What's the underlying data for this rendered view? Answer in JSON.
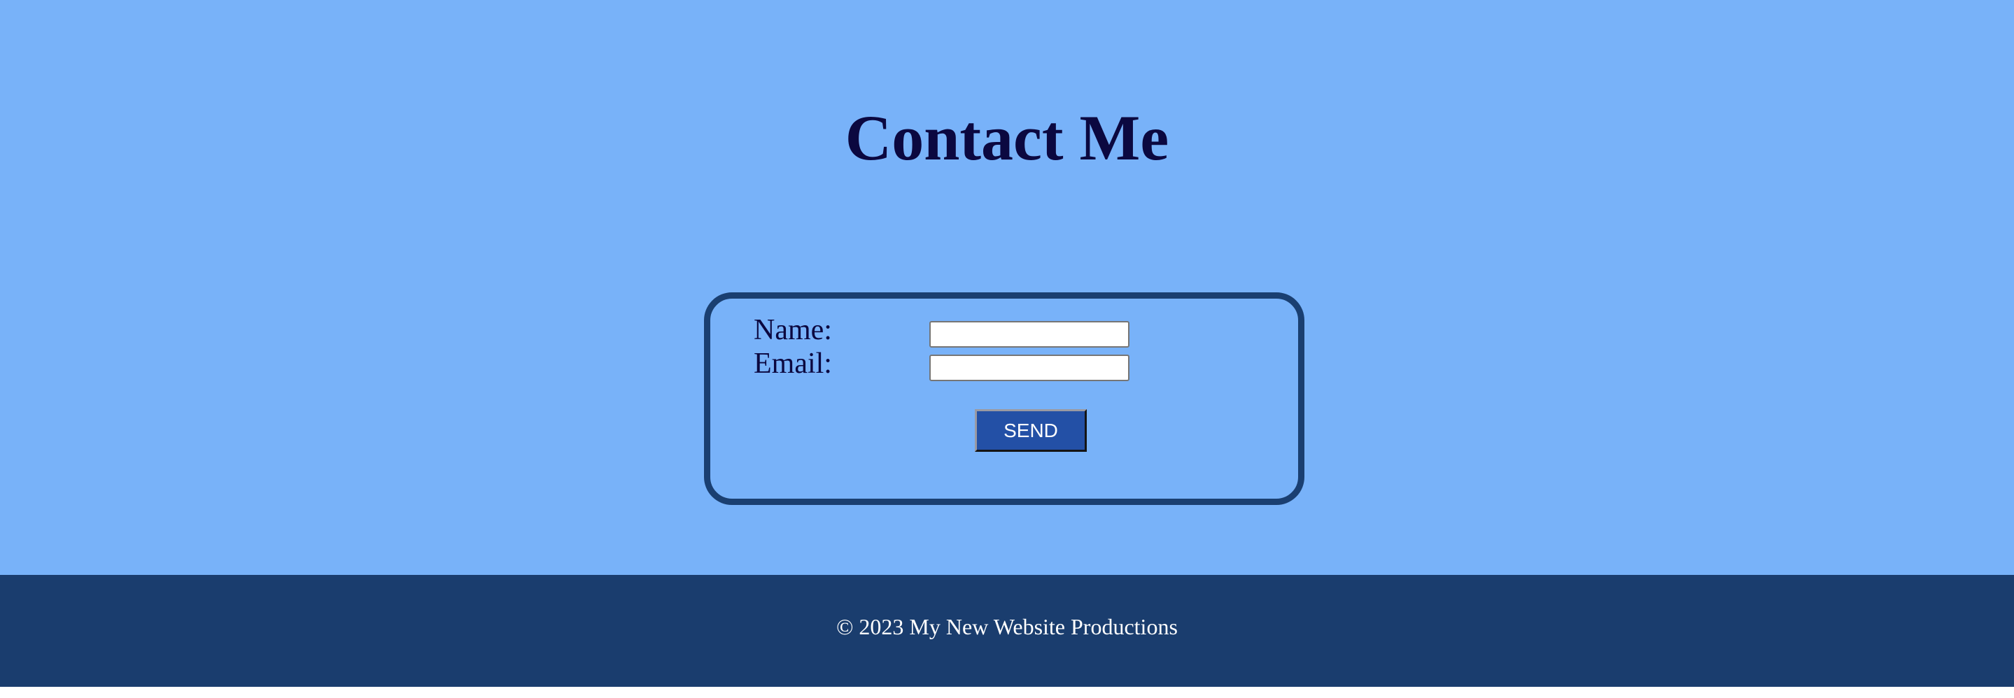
{
  "header": {
    "title": "Contact Me"
  },
  "form": {
    "name_label": "Name:",
    "name_value": "",
    "email_label": "Email:",
    "email_value": "",
    "send_label": "SEND"
  },
  "footer": {
    "text": "© 2023 My New Website Productions"
  },
  "colors": {
    "page_background": "#78b2f9",
    "heading_text": "#0b0840",
    "form_border": "#1a3f71",
    "button_background": "#2350a6",
    "footer_background": "#1a3d6e",
    "footer_text": "#ffffff"
  }
}
